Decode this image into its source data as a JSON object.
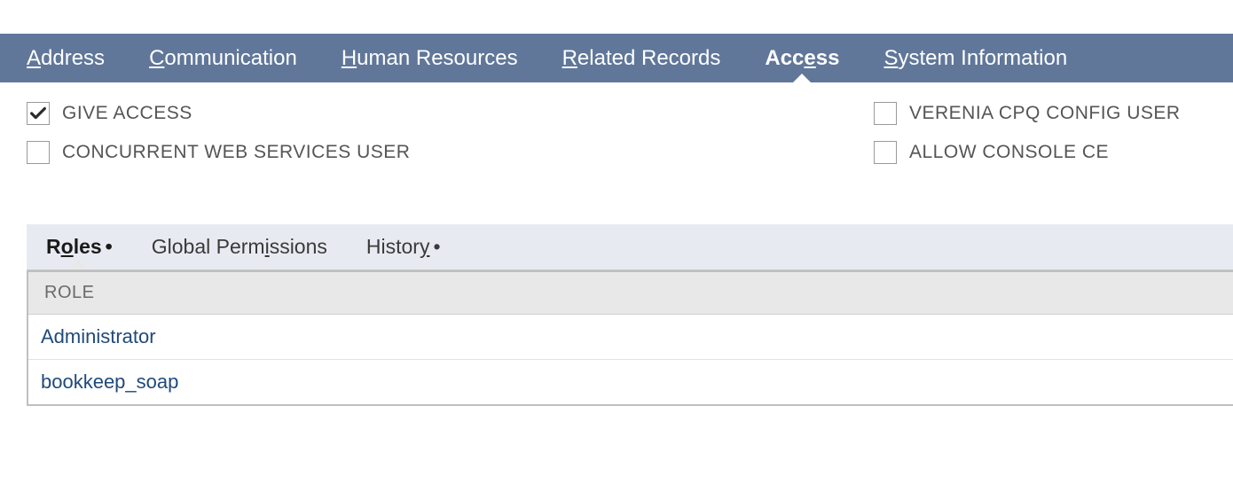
{
  "topTabs": [
    {
      "pre": "",
      "u": "A",
      "post": "ddress",
      "active": false
    },
    {
      "pre": "",
      "u": "C",
      "post": "ommunication",
      "active": false
    },
    {
      "pre": "",
      "u": "H",
      "post": "uman Resources",
      "active": false
    },
    {
      "pre": "",
      "u": "R",
      "post": "elated Records",
      "active": false
    },
    {
      "pre": "Acc",
      "u": "e",
      "post": "ss",
      "active": true
    },
    {
      "pre": "",
      "u": "S",
      "post": "ystem Information",
      "active": false
    }
  ],
  "checks": {
    "col1": [
      {
        "label": "GIVE ACCESS",
        "checked": true
      },
      {
        "label": "CONCURRENT WEB SERVICES USER",
        "checked": false
      }
    ],
    "col2": [
      {
        "label": "VERENIA CPQ CONFIG USER",
        "checked": false
      },
      {
        "label": "ALLOW CONSOLE CE",
        "checked": false
      }
    ]
  },
  "subTabs": [
    {
      "pre": "R",
      "u": "o",
      "post": "les",
      "dot": true,
      "active": true
    },
    {
      "pre": "Global Perm",
      "u": "i",
      "post": "ssions",
      "dot": false,
      "active": false
    },
    {
      "pre": "Histor",
      "u": "y",
      "post": "",
      "dot": true,
      "active": false
    }
  ],
  "table": {
    "header": "ROLE",
    "rows": [
      "Administrator",
      "bookkeep_soap"
    ]
  }
}
